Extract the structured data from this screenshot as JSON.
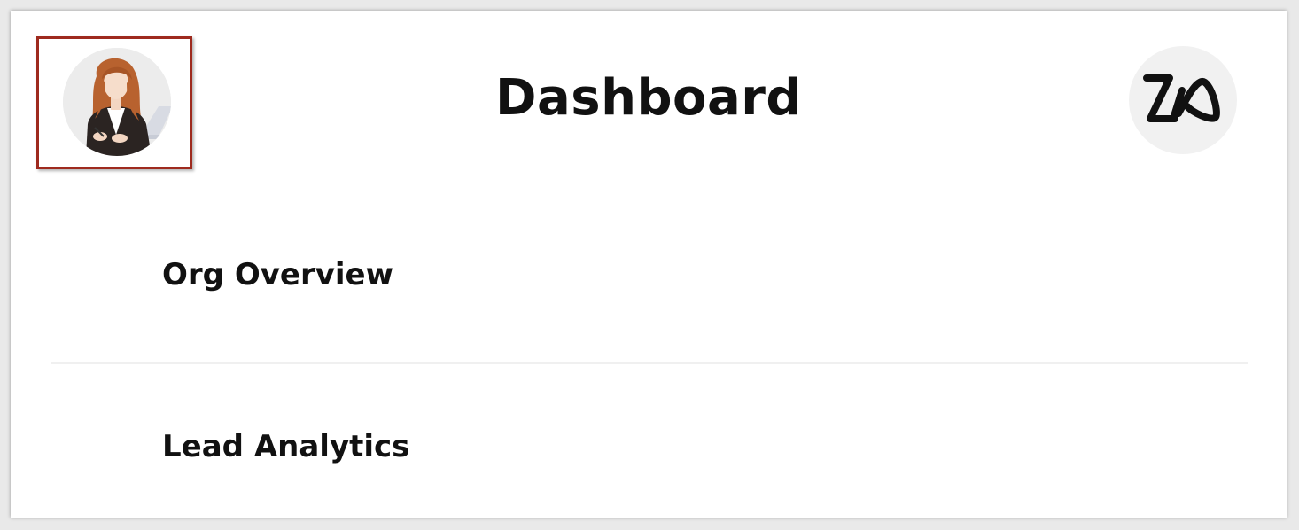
{
  "header": {
    "title": "Dashboard",
    "avatar_icon": "user-avatar-icon",
    "assistant_icon": "zia-logo-icon",
    "highlight_color": "#9e2a1e"
  },
  "menu": {
    "items": [
      {
        "label": "Org Overview"
      },
      {
        "label": "Lead Analytics"
      }
    ]
  }
}
